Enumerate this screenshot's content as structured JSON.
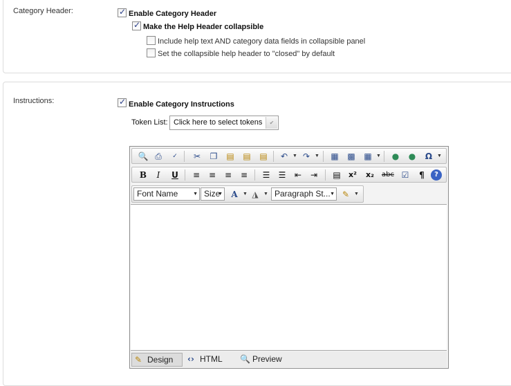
{
  "category_header": {
    "label": "Category Header:",
    "enable_label": "Enable Category Header",
    "enable_checked": true,
    "collapsible_label": "Make the Help Header collapsible",
    "collapsible_checked": true,
    "include_help_label": "Include help text AND category data fields in collapsible panel",
    "include_help_checked": false,
    "closed_default_label": "Set the collapsible help header to \"closed\" by default",
    "closed_default_checked": false
  },
  "instructions": {
    "label": "Instructions:",
    "enable_label": "Enable Category Instructions",
    "enable_checked": true,
    "token_list_label": "Token List:",
    "token_select_value": "Click here to select tokens"
  },
  "editor": {
    "toolbar1_icons": [
      "find-icon",
      "print-icon",
      "spellcheck-icon",
      "cut-icon",
      "copy-icon",
      "paste-icon",
      "paste-text-icon",
      "paste-word-icon",
      "undo-icon",
      "redo-icon",
      "insert-image-icon",
      "image-manager-icon",
      "table-icon",
      "link-icon",
      "unlink-icon",
      "special-char-icon"
    ],
    "toolbar2_labels": {
      "bold": "B",
      "italic": "I",
      "underline": "U",
      "superscript": "x²",
      "subscript": "x₂",
      "strike": "abc",
      "paragraph": "¶",
      "help": "?"
    },
    "font_name": "Font Name",
    "size": "Size",
    "paragraph_style": "Paragraph St...",
    "modes": {
      "design": "Design",
      "html": "HTML",
      "preview": "Preview"
    },
    "active_mode": "Design",
    "accent_color": "#2a4a8a"
  }
}
